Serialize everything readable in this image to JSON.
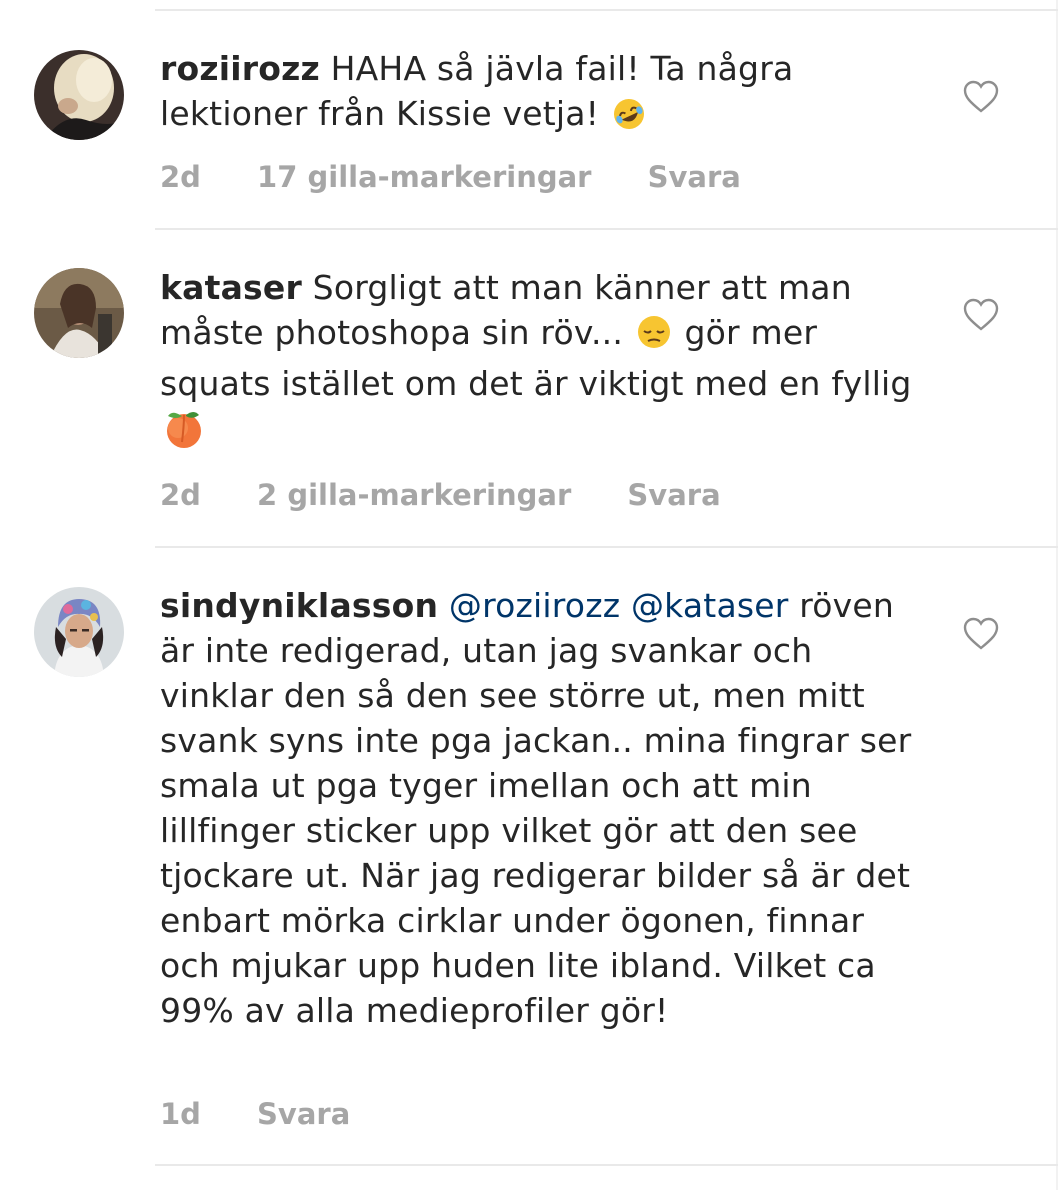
{
  "comments": [
    {
      "username": "roziirozz",
      "text_before_emoji": "HAHA så jävla fail! Ta några lektioner från Kissie vetja!",
      "emoji": "rolling-on-floor-laughing-emoji",
      "time": "2d",
      "likes": "17 gilla-markeringar",
      "reply": "Svara"
    },
    {
      "username": "kataser",
      "text_part1": "Sorgligt att man känner att man måste photoshopa sin röv...",
      "emoji1": "pensive-face-emoji",
      "text_part2": "gör mer squats istället om det är viktigt med en fyllig",
      "emoji2": "peach-emoji",
      "time": "2d",
      "likes": "2 gilla-markeringar",
      "reply": "Svara"
    },
    {
      "username": "sindyniklasson",
      "mention1": "@roziirozz",
      "mention2": "@kataser",
      "text": "röven är inte redigerad, utan jag svankar och vinklar den så den see större ut, men mitt svank syns inte pga jackan.. mina fingrar ser smala ut pga tyger imellan och att min lillfinger sticker upp vilket gör att den see tjockare ut. När jag redigerar bilder så är det enbart mörka cirklar under ögonen, finnar och mjukar upp huden lite ibland. Vilket ca 99% av alla medieprofiler gör!",
      "time": "1d",
      "reply": "Svara"
    }
  ],
  "colors": {
    "text": "#262626",
    "meta": "#a6a6a6",
    "mention": "#003569",
    "divider": "#e9e9e9"
  }
}
